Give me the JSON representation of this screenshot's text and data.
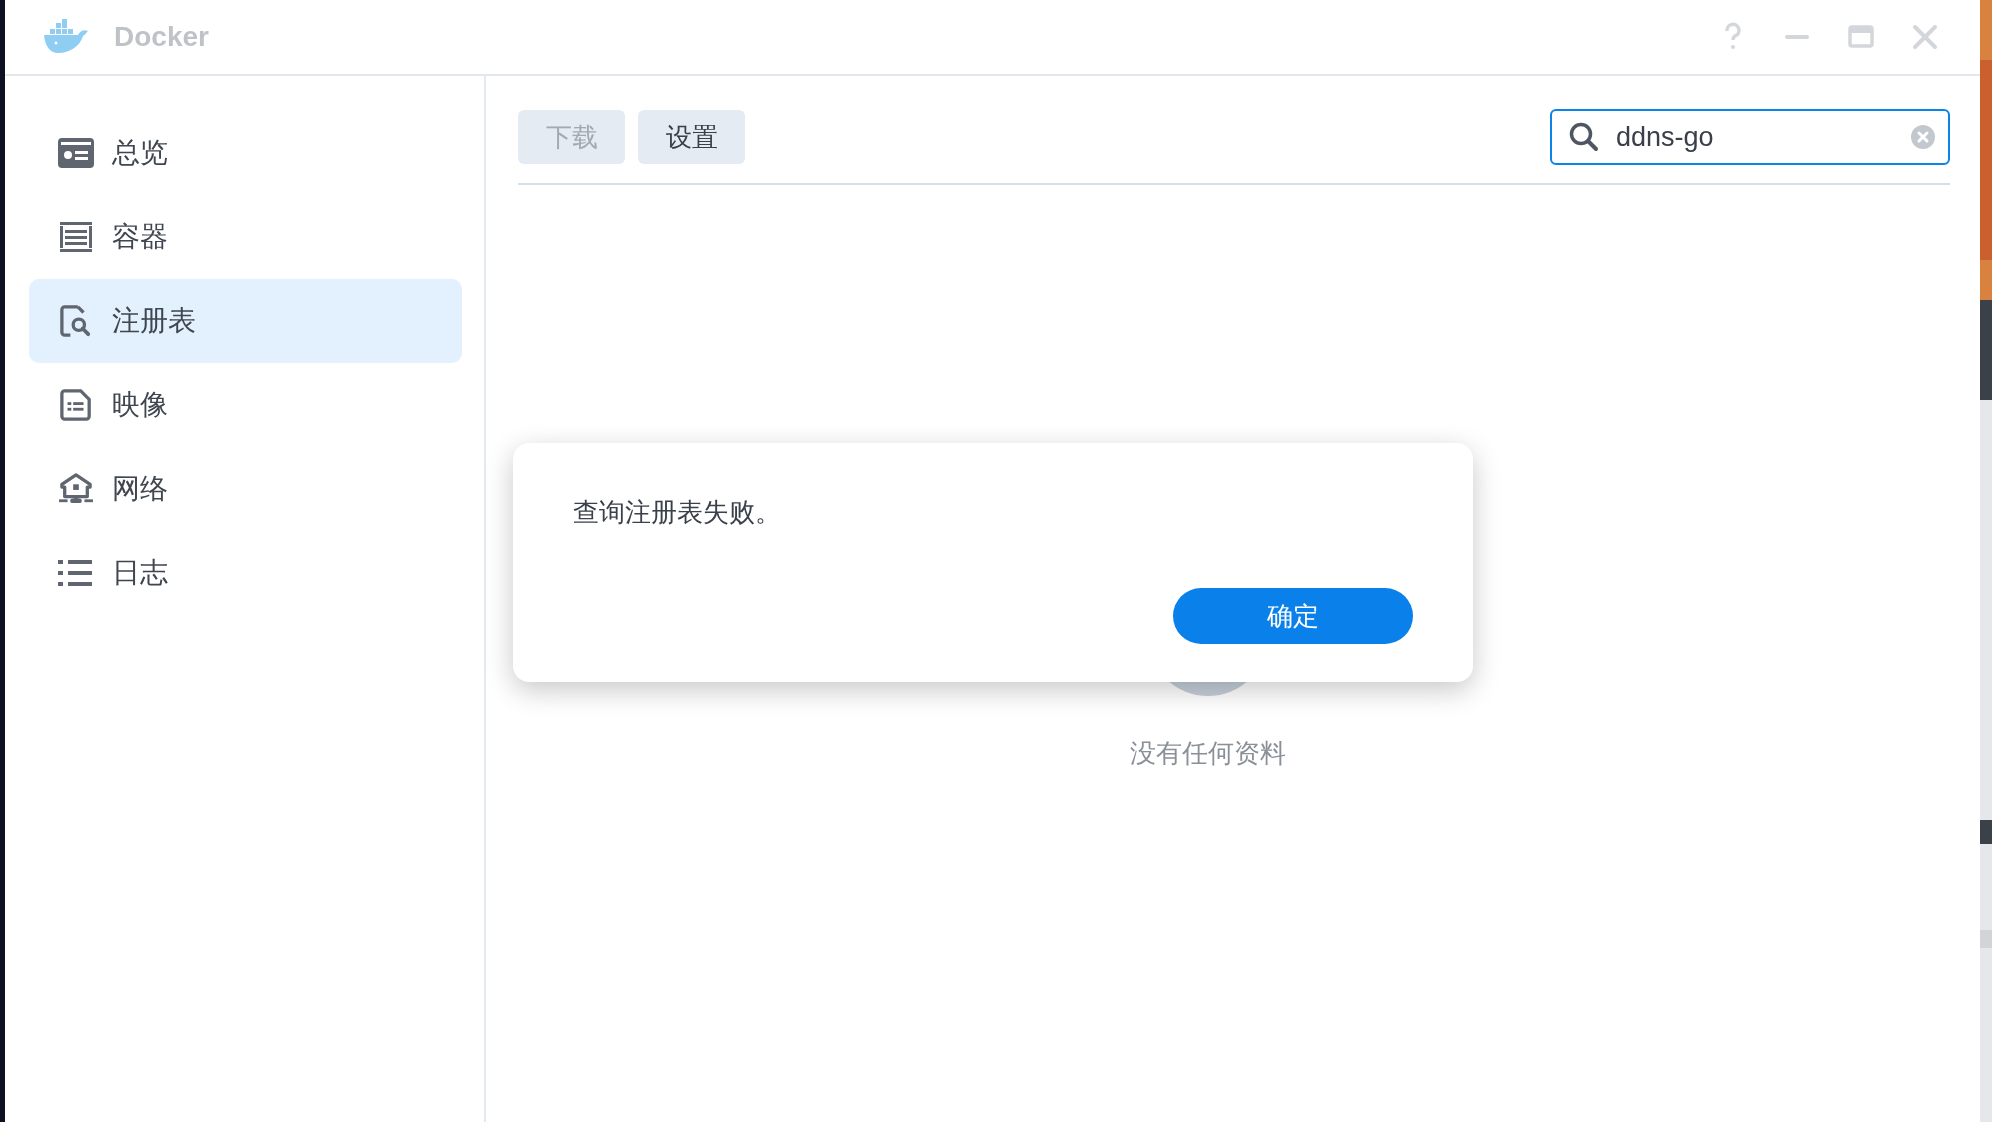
{
  "window": {
    "title": "Docker"
  },
  "sidebar": {
    "items": [
      {
        "label": "总览",
        "kind": "overview",
        "selected": false
      },
      {
        "label": "容器",
        "kind": "container",
        "selected": false
      },
      {
        "label": "注册表",
        "kind": "registry",
        "selected": true
      },
      {
        "label": "映像",
        "selected": false
      },
      {
        "label": "网络",
        "kind": "network",
        "selected": false
      },
      {
        "label": "日志",
        "kind": "log",
        "selected": false
      }
    ]
  },
  "toolbar": {
    "buttons": [
      {
        "label": "下载",
        "disabled": true
      },
      {
        "label": "设置",
        "disabled": false
      }
    ]
  },
  "search": {
    "value": "ddns-go"
  },
  "empty_state": {
    "text": "没有任何资料"
  },
  "dialog": {
    "message": "查询注册表失败。",
    "button": "确定"
  }
}
